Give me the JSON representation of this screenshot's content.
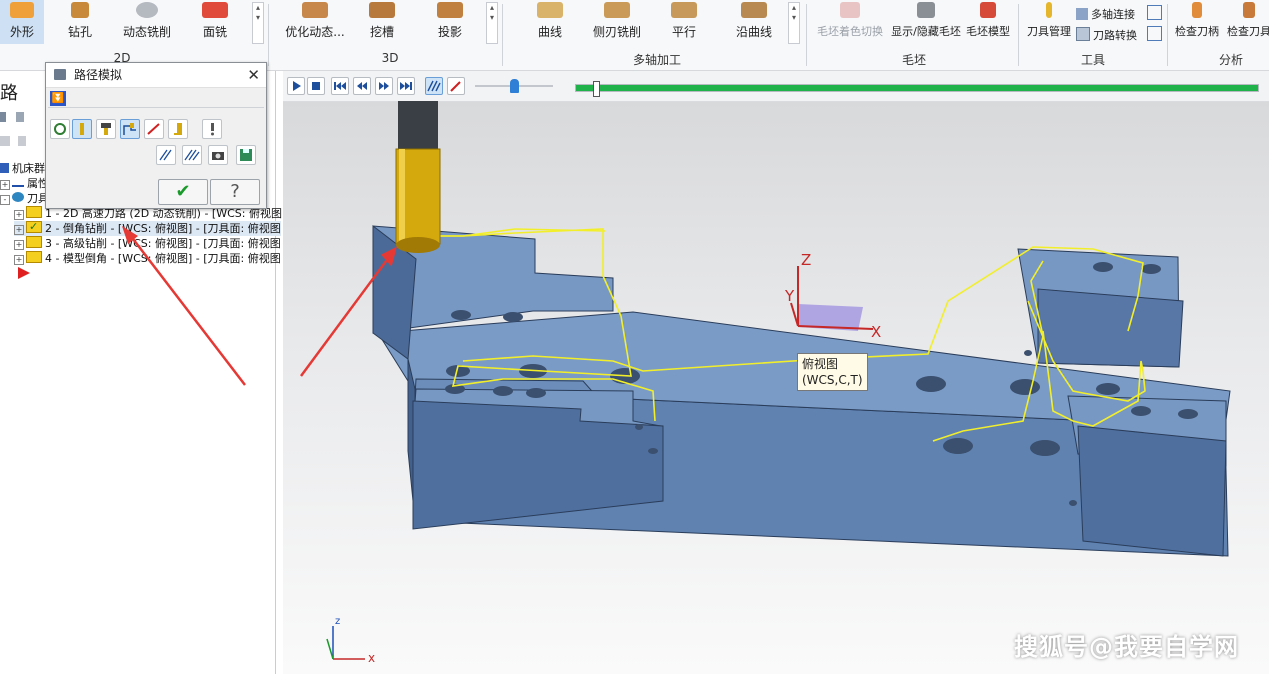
{
  "ribbon": {
    "buttons": {
      "outline": "外形",
      "drill": "钻孔",
      "dynamic_mill": "动态铣削",
      "face_mill": "面铣",
      "optimize_dynamic": "优化动态...",
      "pocket": "挖槽",
      "project": "投影",
      "curve": "曲线",
      "side_blade": "侧刃铣削",
      "parallel": "平行",
      "along_curve": "沿曲线",
      "stock_shade_toggle": "毛坯着色切换",
      "show_hide_stock": "显示/隐藏毛坯",
      "stock_model": "毛坯模型",
      "tool_manager": "刀具管理",
      "multiaxis_link": "多轴连接",
      "path_transform": "刀路转换",
      "check_holder": "检查刀柄",
      "check_tool": "检查刀具"
    },
    "groups": {
      "g2d": "2D",
      "g3d": "3D",
      "multiaxis": "多轴加工",
      "stock": "毛坯",
      "tools": "工具",
      "analysis": "分析"
    }
  },
  "left_panel": {
    "title_fragment": "路",
    "tree": [
      {
        "label": "机床群"
      },
      {
        "label": "属性"
      },
      {
        "label": "刀具"
      },
      {
        "label": "1 - 2D 高速刀路 (2D 动态铣削) - [WCS: 俯视图]"
      },
      {
        "label": "2 - 倒角钻削 - [WCS: 俯视图] - [刀具面: 俯视图"
      },
      {
        "label": "3 - 高级钻削 - [WCS: 俯视图] - [刀具面: 俯视图"
      },
      {
        "label": "4 - 模型倒角 - [WCS: 俯视图] - [刀具面: 俯视图"
      }
    ]
  },
  "dialog": {
    "title": "路径模拟",
    "ok_icon": "check-icon",
    "help_icon": "question-icon"
  },
  "viewport": {
    "tooltip_line1": "俯视图",
    "tooltip_line2": "(WCS,C,T)",
    "axis_z": "Z",
    "axis_y": "Y",
    "axis_x": "X",
    "mini_z": "z",
    "mini_x": "x"
  },
  "simulation": {
    "progress_fraction": 1.0,
    "speed_fraction": 0.5
  },
  "watermark": "搜狐号@我要自学网",
  "colors": {
    "part": "#6b8fbd",
    "part_side": "#4f6f9c",
    "toolpath": "#f2ef2a",
    "progress": "#1fb14a",
    "annotation_arrow": "#e53935",
    "tool_body": "#e0b400"
  }
}
